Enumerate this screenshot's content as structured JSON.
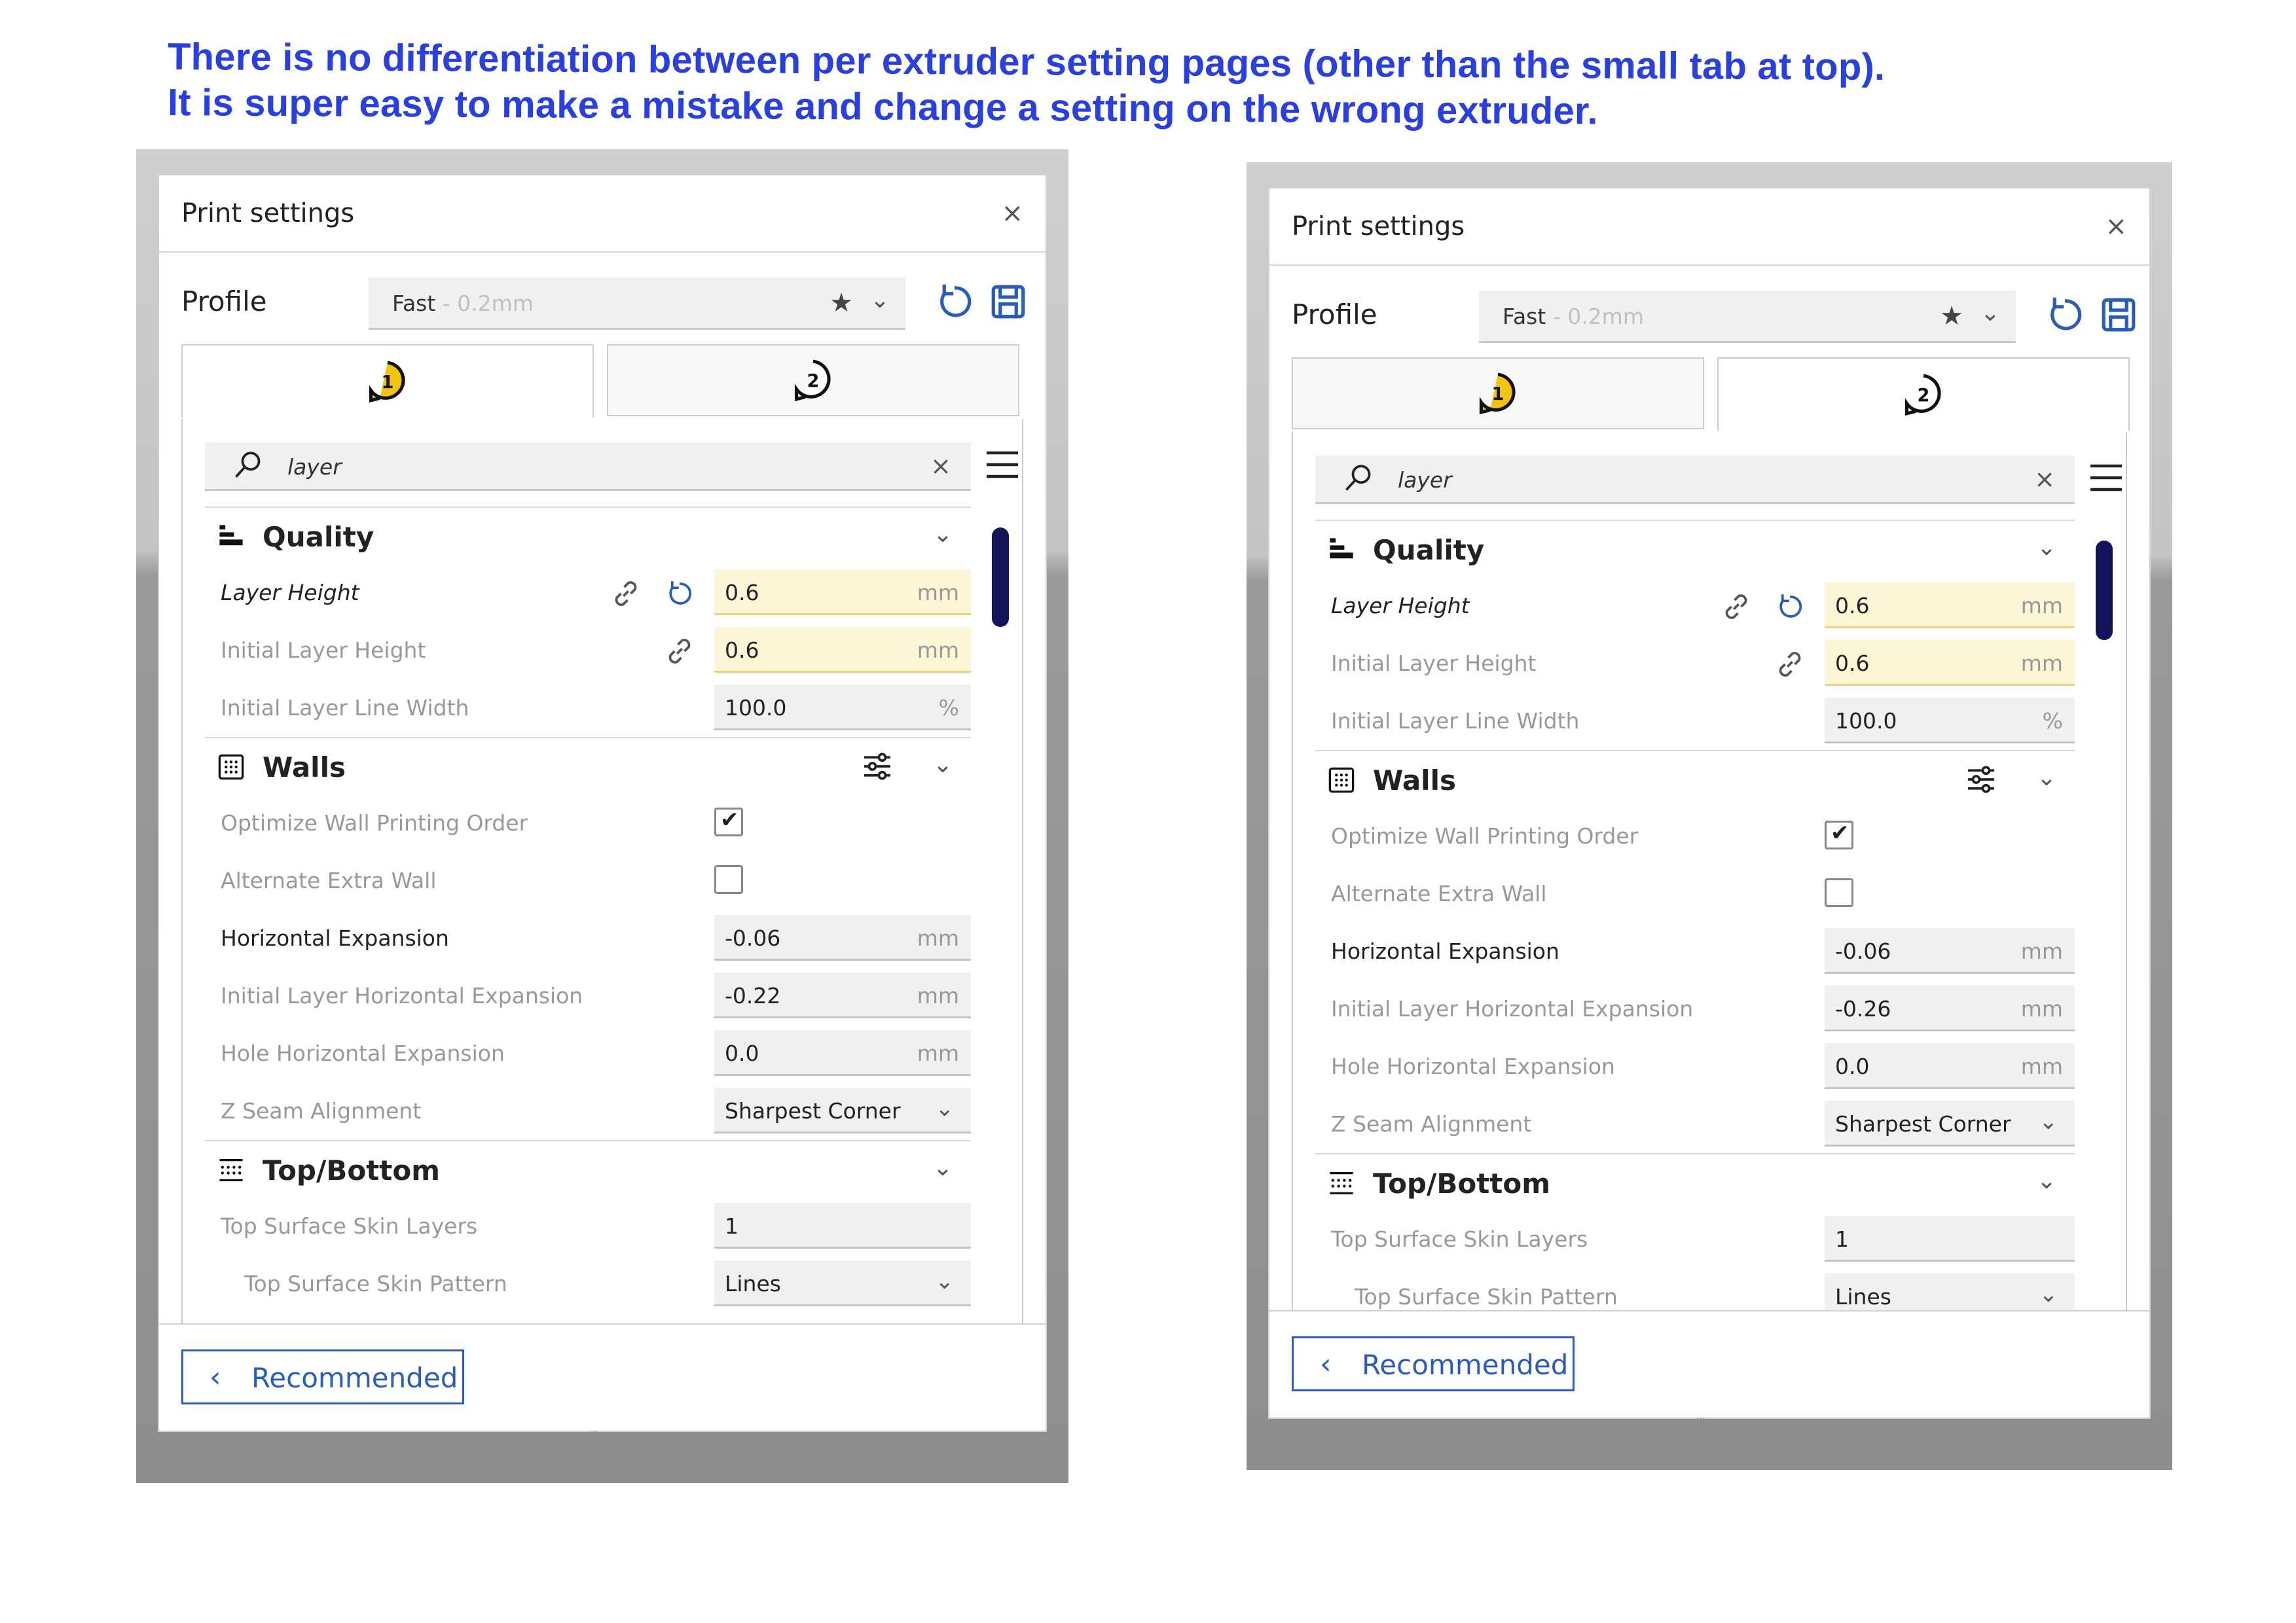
{
  "annotation": {
    "line1": "There is no differentiation between per extruder setting pages (other than the small tab at top).",
    "line2": "It is super easy to make a mistake and change a setting on the wrong extruder."
  },
  "colors": {
    "annotation": "#2a3fe0",
    "accent": "#2a5cb8",
    "highlight_field": "#fdf6d6",
    "scrollbar": "#14145a",
    "extruder_badge": "#f2c40c"
  },
  "panels": [
    {
      "title": "Print settings",
      "close": "×",
      "profile_label": "Profile",
      "profile_name": "Fast",
      "profile_suffix": " - 0.2mm",
      "tabs": [
        {
          "label": "1",
          "active": true
        },
        {
          "label": "2",
          "active": false
        }
      ],
      "search_value": "layer",
      "quality": {
        "label": "Quality",
        "layer_height": {
          "label": "Layer Height",
          "value": "0.6",
          "unit": "mm"
        },
        "initial_layer_height": {
          "label": "Initial Layer Height",
          "value": "0.6",
          "unit": "mm"
        },
        "initial_layer_line_width": {
          "label": "Initial Layer Line Width",
          "value": "100.0",
          "unit": "%"
        }
      },
      "walls": {
        "label": "Walls",
        "optimize_wall_printing_order": {
          "label": "Optimize Wall Printing Order",
          "checked": true
        },
        "alternate_extra_wall": {
          "label": "Alternate Extra Wall",
          "checked": false
        },
        "horizontal_expansion": {
          "label": "Horizontal Expansion",
          "value": "-0.06",
          "unit": "mm"
        },
        "initial_layer_horizontal_expansion": {
          "label": "Initial Layer Horizontal Expansion",
          "value": "-0.22",
          "unit": "mm"
        },
        "hole_horizontal_expansion": {
          "label": "Hole Horizontal Expansion",
          "value": "0.0",
          "unit": "mm"
        },
        "z_seam_alignment": {
          "label": "Z Seam Alignment",
          "value": "Sharpest Corner"
        }
      },
      "top_bottom": {
        "label": "Top/Bottom",
        "top_surface_skin_layers": {
          "label": "Top Surface Skin Layers",
          "value": "1"
        },
        "top_surface_skin_pattern": {
          "label": "Top Surface Skin Pattern",
          "value": "Lines"
        }
      },
      "recommended": "Recommended"
    },
    {
      "title": "Print settings",
      "close": "×",
      "profile_label": "Profile",
      "profile_name": "Fast",
      "profile_suffix": " - 0.2mm",
      "tabs": [
        {
          "label": "1",
          "active": false
        },
        {
          "label": "2",
          "active": true
        }
      ],
      "search_value": "layer",
      "quality": {
        "label": "Quality",
        "layer_height": {
          "label": "Layer Height",
          "value": "0.6",
          "unit": "mm"
        },
        "initial_layer_height": {
          "label": "Initial Layer Height",
          "value": "0.6",
          "unit": "mm"
        },
        "initial_layer_line_width": {
          "label": "Initial Layer Line Width",
          "value": "100.0",
          "unit": "%"
        }
      },
      "walls": {
        "label": "Walls",
        "optimize_wall_printing_order": {
          "label": "Optimize Wall Printing Order",
          "checked": true
        },
        "alternate_extra_wall": {
          "label": "Alternate Extra Wall",
          "checked": false
        },
        "horizontal_expansion": {
          "label": "Horizontal Expansion",
          "value": "-0.06",
          "unit": "mm"
        },
        "initial_layer_horizontal_expansion": {
          "label": "Initial Layer Horizontal Expansion",
          "value": "-0.26",
          "unit": "mm"
        },
        "hole_horizontal_expansion": {
          "label": "Hole Horizontal Expansion",
          "value": "0.0",
          "unit": "mm"
        },
        "z_seam_alignment": {
          "label": "Z Seam Alignment",
          "value": "Sharpest Corner"
        }
      },
      "top_bottom": {
        "label": "Top/Bottom",
        "top_surface_skin_layers": {
          "label": "Top Surface Skin Layers",
          "value": "1"
        },
        "top_surface_skin_pattern": {
          "label": "Top Surface Skin Pattern",
          "value": "Lines"
        }
      },
      "recommended": "Recommended"
    }
  ]
}
